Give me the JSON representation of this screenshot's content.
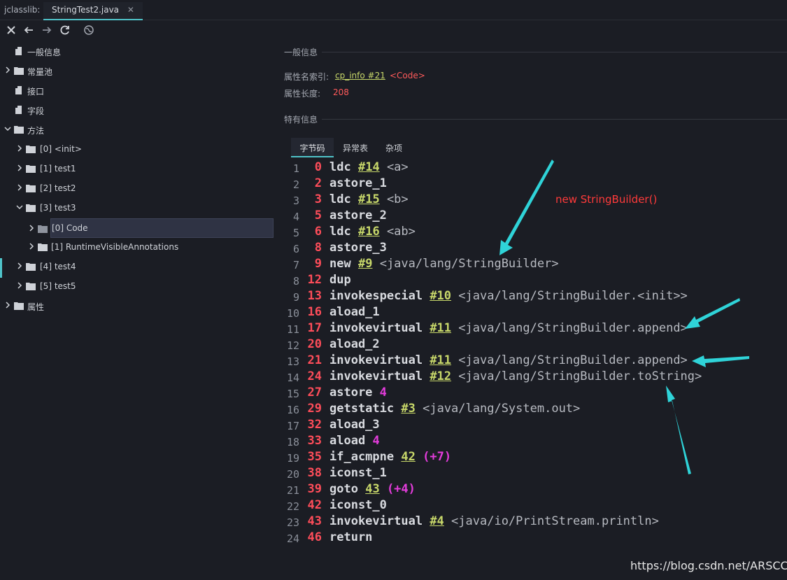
{
  "tabs": {
    "prefix": "jclasslib:",
    "active": "StringTest2.java",
    "close": "✕"
  },
  "tree": {
    "general": "一般信息",
    "constant_pool": "常量池",
    "interfaces": "接口",
    "fields": "字段",
    "methods": "方法",
    "m0": "[0] <init>",
    "m1": "[1] test1",
    "m2": "[2] test2",
    "m3": "[3] test3",
    "m3_code": "[0] Code",
    "m3_rva": "[1] RuntimeVisibleAnnotations",
    "m4": "[4] test4",
    "m5": "[5] test5",
    "attributes": "属性"
  },
  "panel": {
    "general_title": "一般信息",
    "name_index_label": "属性名索引:",
    "name_index_link": "cp_info #21",
    "name_index_value": "<Code>",
    "length_label": "属性长度:",
    "length_value": "208",
    "specific_title": "特有信息",
    "subtabs": [
      "字节码",
      "异常表",
      "杂项"
    ]
  },
  "code": [
    {
      "ln": "1",
      "off": "0",
      "op": "ldc",
      "ref": "#14",
      "cmt": "<a>"
    },
    {
      "ln": "2",
      "off": "2",
      "op": "astore_1"
    },
    {
      "ln": "3",
      "off": "3",
      "op": "ldc",
      "ref": "#15",
      "cmt": "<b>"
    },
    {
      "ln": "4",
      "off": "5",
      "op": "astore_2"
    },
    {
      "ln": "5",
      "off": "6",
      "op": "ldc",
      "ref": "#16",
      "cmt": "<ab>"
    },
    {
      "ln": "6",
      "off": "8",
      "op": "astore_3"
    },
    {
      "ln": "7",
      "off": "9",
      "op": "new",
      "ref": "#9",
      "cmt": "<java/lang/StringBuilder>"
    },
    {
      "ln": "8",
      "off": "12",
      "op": "dup"
    },
    {
      "ln": "9",
      "off": "13",
      "op": "invokespecial",
      "ref": "#10",
      "cmt": "<java/lang/StringBuilder.<init>>"
    },
    {
      "ln": "10",
      "off": "16",
      "op": "aload_1"
    },
    {
      "ln": "11",
      "off": "17",
      "op": "invokevirtual",
      "ref": "#11",
      "cmt": "<java/lang/StringBuilder.append>"
    },
    {
      "ln": "12",
      "off": "20",
      "op": "aload_2"
    },
    {
      "ln": "13",
      "off": "21",
      "op": "invokevirtual",
      "ref": "#11",
      "cmt": "<java/lang/StringBuilder.append>"
    },
    {
      "ln": "14",
      "off": "24",
      "op": "invokevirtual",
      "ref": "#12",
      "cmt": "<java/lang/StringBuilder.toString>"
    },
    {
      "ln": "15",
      "off": "27",
      "op": "astore",
      "num": "4"
    },
    {
      "ln": "16",
      "off": "29",
      "op": "getstatic",
      "ref": "#3",
      "cmt": "<java/lang/System.out>"
    },
    {
      "ln": "17",
      "off": "32",
      "op": "aload_3"
    },
    {
      "ln": "18",
      "off": "33",
      "op": "aload",
      "num": "4"
    },
    {
      "ln": "19",
      "off": "35",
      "op": "if_acmpne",
      "ref": "42",
      "num": "(+7)"
    },
    {
      "ln": "20",
      "off": "38",
      "op": "iconst_1"
    },
    {
      "ln": "21",
      "off": "39",
      "op": "goto",
      "ref": "43",
      "num": "(+4)"
    },
    {
      "ln": "22",
      "off": "42",
      "op": "iconst_0"
    },
    {
      "ln": "23",
      "off": "43",
      "op": "invokevirtual",
      "ref": "#4",
      "cmt": "<java/io/PrintStream.println>"
    },
    {
      "ln": "24",
      "off": "46",
      "op": "return"
    }
  ],
  "annotation": "new StringBuilder()",
  "watermark": "https://blog.csdn.net/ARSCCC",
  "colors": {
    "accent": "#4fc3c9",
    "offset": "#ff4d5a",
    "ref": "#c8d86a",
    "number": "#e43cdc",
    "annotation": "#ff3a3a"
  }
}
